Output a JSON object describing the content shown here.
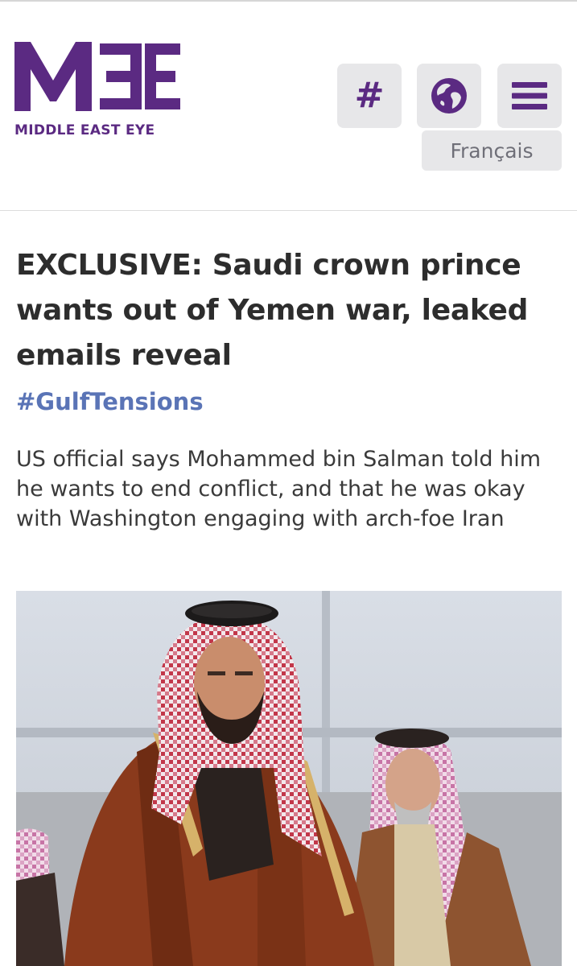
{
  "brand": {
    "logo_text": "MIDDLE EAST EYE",
    "color": "#5b2a82"
  },
  "header": {
    "buttons": [
      {
        "label": "#",
        "icon": "hashtag-icon"
      },
      {
        "icon": "globe-icon"
      },
      {
        "icon": "hamburger-menu-icon"
      }
    ],
    "language_button": "Français",
    "button_background": "#e7e7e9"
  },
  "article": {
    "headline": "EXCLUSIVE: Saudi crown prince wants out of Yemen war, leaked emails reveal",
    "tag": "#GulfTensions",
    "tag_color": "#5a74b6",
    "standfirst": "US official says Mohammed bin Salman told him he wants to end conflict, and that he was okay with Washington engaging with arch-foe Iran",
    "image": {
      "icon": "article-photo"
    }
  }
}
